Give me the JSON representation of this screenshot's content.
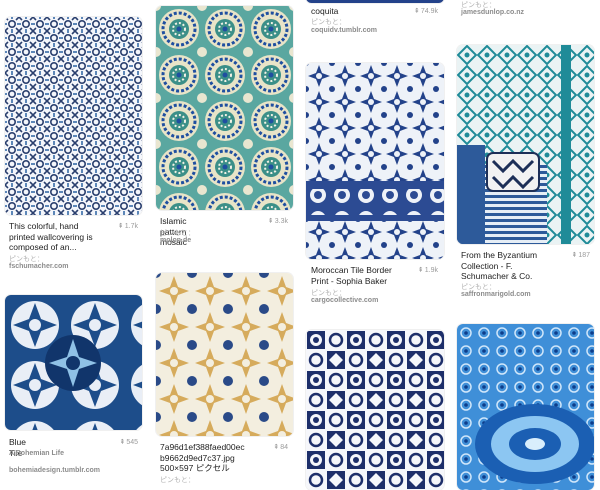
{
  "colors": {
    "accent": "#1f4fa0",
    "text": "#222222",
    "muted": "#9a9a9a"
  },
  "pins": [
    {
      "id": "top2",
      "description": "coquita",
      "repins": "74.9k",
      "via": "ピンもと：",
      "source": "coquidv.tumblr.com"
    },
    {
      "id": "top3",
      "via": "ピンもと：",
      "source": "jamesdunlop.co.nz"
    },
    {
      "id": "p1",
      "description": "This colorful, hand\nprinted wallcovering is\ncomposed of an...",
      "repins": "1.7k",
      "via": "ピンもと：",
      "source": "fschumacher.com"
    },
    {
      "id": "p2",
      "description": "Islamic pattern mosaic",
      "repins": "3.3k",
      "via": "ピンもと：",
      "source": "molon.de"
    },
    {
      "id": "p3",
      "description": "Moroccan Tile Border\nPrint - Sophia Baker",
      "repins": "1.9k",
      "via": "ピンもと：",
      "source": "cargocollective.com"
    },
    {
      "id": "p4",
      "description": "From the Byzantium\nCollection - F.\nSchumacher & Co.",
      "repins": "187",
      "via": "ピンもと：",
      "source": "saffronmarigold.com"
    },
    {
      "id": "p5",
      "description": "Blue Tile",
      "repins": "545",
      "board": "A Bohemian Life",
      "source": "bohemiadesign.tumblr.com"
    },
    {
      "id": "p6",
      "description": "7a96d1ef388faed00ec\nb9662d9ed7c37.jpg\n500×597 ピクセル",
      "repins": "84",
      "via": "ピンもと："
    }
  ]
}
